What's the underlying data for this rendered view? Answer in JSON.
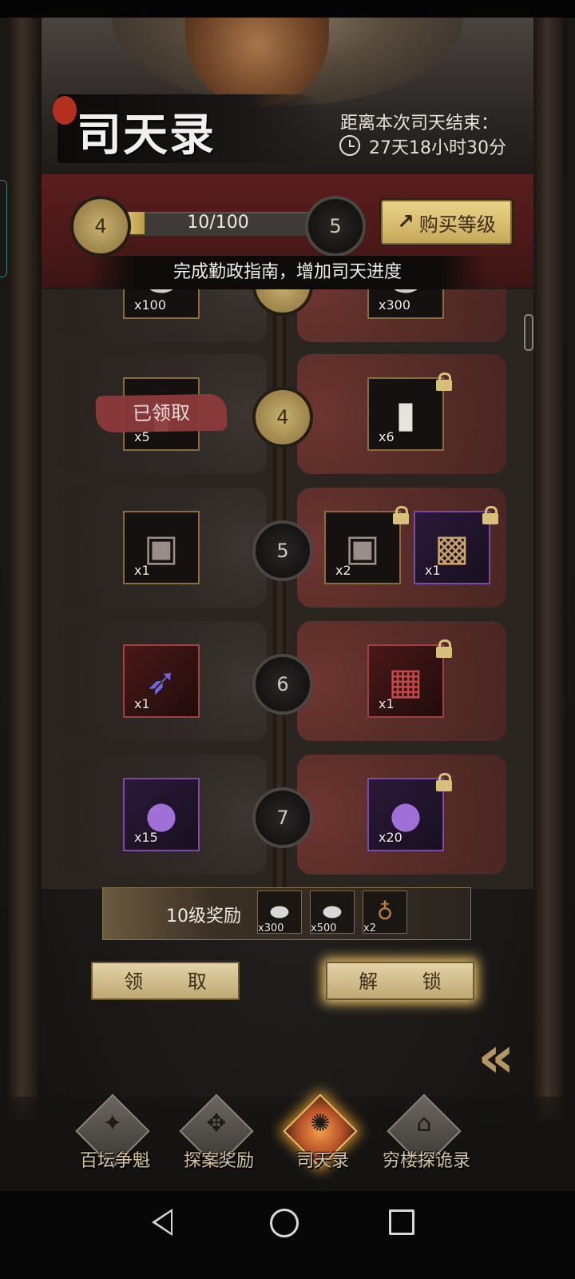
{
  "header": {
    "title": "司天录",
    "countdown_label": "距离本次司天结束：",
    "countdown_value": "27天18小时30分"
  },
  "level_bar": {
    "current_level": "4",
    "next_level": "5",
    "progress_text": "10/100",
    "progress_fraction": 0.1,
    "buy_button_label": "购买等级",
    "hint": "完成勤政指南，增加司天进度"
  },
  "rows": [
    {
      "level": "",
      "free_items": [
        {
          "icon": "silver-icon",
          "qty": "x100"
        }
      ],
      "paid_items": [
        {
          "icon": "silver-icon",
          "qty": "x300"
        }
      ]
    },
    {
      "level": "4",
      "claimed_label": "已领取",
      "free_items": [
        {
          "icon": "silk-roll-icon",
          "qty": "x5"
        }
      ],
      "paid_items": [
        {
          "icon": "silk-roll-icon",
          "qty": "x6",
          "locked": true
        }
      ]
    },
    {
      "level": "5",
      "free_items": [
        {
          "icon": "token-plaque-icon",
          "qty": "x1"
        }
      ],
      "paid_items": [
        {
          "icon": "token-plaque-icon",
          "qty": "x2",
          "locked": true
        },
        {
          "icon": "treasure-chest-icon",
          "qty": "x1",
          "locked": true
        }
      ]
    },
    {
      "level": "6",
      "free_items": [
        {
          "icon": "crossbow-icon",
          "qty": "x1"
        }
      ],
      "paid_items": [
        {
          "icon": "red-chest-icon",
          "qty": "x1",
          "locked": true
        }
      ]
    },
    {
      "level": "7",
      "free_items": [
        {
          "icon": "purple-orb-icon",
          "qty": "x15"
        }
      ],
      "paid_items": [
        {
          "icon": "purple-orb-icon",
          "qty": "x20",
          "locked": true
        }
      ]
    }
  ],
  "bonus": {
    "label": "10级奖励",
    "items": [
      {
        "icon": "silver-ingot-icon",
        "qty": "x300"
      },
      {
        "icon": "silver-ingot-icon",
        "qty": "x500"
      },
      {
        "icon": "money-bag-icon",
        "qty": "x2"
      }
    ]
  },
  "actions": {
    "claim_label": "领 取",
    "unlock_label": "解 锁"
  },
  "tabs": [
    {
      "label": "百坛争魁",
      "icon": "tournament-icon",
      "active": false
    },
    {
      "label": "探案奖励",
      "icon": "case-reward-icon",
      "active": false
    },
    {
      "label": "司天录",
      "icon": "sky-record-icon",
      "active": true
    },
    {
      "label": "穷楼探诡录",
      "icon": "tower-icon",
      "active": false
    }
  ],
  "colors": {
    "accent_gold": "#d7bf6f",
    "paid_red": "#5a2e29",
    "active_tab": "#f3a04a"
  }
}
